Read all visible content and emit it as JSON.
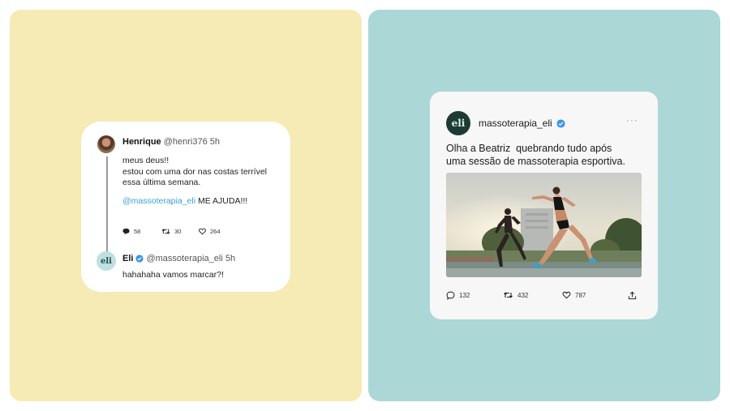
{
  "thread": {
    "author_name": "Henrique",
    "author_meta": "@henri376 5h",
    "body_lines": [
      "meus deus!!",
      "estou com uma dor nas costas terrível",
      "essa última semana."
    ],
    "mention": "@massoterapia_eli",
    "mention_suffix": " ME AJUDA!!!",
    "replies_count": "58",
    "retweets_count": "30",
    "likes_count": "264",
    "reply": {
      "avatar_text": "eli",
      "author_name": "Eli",
      "author_meta": "@massoterapia_eli 5h",
      "body": "hahahaha vamos marcar?!"
    }
  },
  "post": {
    "avatar_text": "eli",
    "handle": "massoterapia_eli",
    "more": "···",
    "text": "Olha a Beatriz  quebrando tudo após\numa sessão de massoterapia esportiva.",
    "comments_count": "132",
    "retweets_count": "432",
    "likes_count": "787"
  },
  "colors": {
    "left_panel": "#f6eab5",
    "right_panel": "#acd7d7",
    "mention": "#3aa0d8",
    "verified": "#3b94e8",
    "eli_dark": "#1d3b34"
  }
}
